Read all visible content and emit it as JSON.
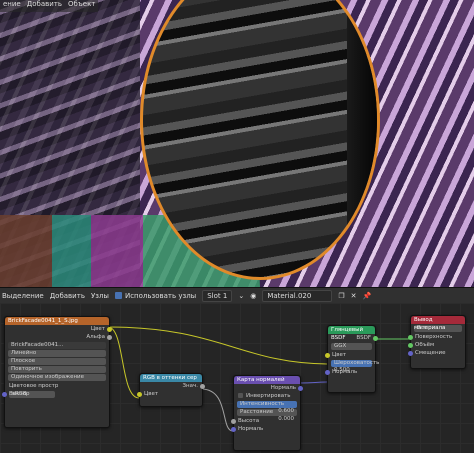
{
  "viewport_menu": [
    "ение",
    "Добавить",
    "Объект"
  ],
  "header": {
    "items": [
      "Выделение",
      "Добавить",
      "Узлы"
    ],
    "use_nodes_label": "Использовать узлы",
    "slot": "Slot 1",
    "material": "Material.020"
  },
  "image_node": {
    "title": "BrickFacade0041_1_S.jpg",
    "out_color": "Цвет",
    "out_alpha": "Альфа",
    "image_name": "BrickFacade0041...",
    "interp": "Линейно",
    "proj": "Плоское",
    "ext": "Повторить",
    "source": "Одиночное изображение",
    "colorspace_label": "Цветовое простр",
    "colorspace_value": "sRGB",
    "in_vector": "Вектор"
  },
  "rgbbw_node": {
    "title": "RGB в оттенки сер",
    "out": "Знач.",
    "in": "Цвет"
  },
  "normal_node": {
    "title": "Карта нормалей",
    "out": "Нормаль",
    "invert": "Инвертировать",
    "strength_label": "Интенсивность",
    "strength": "0.600",
    "distance_label": "Расстояние",
    "distance": "0.000",
    "height": "Высота",
    "normal_in": "Нормаль"
  },
  "glossy_node": {
    "title": "Глянцевый BSDF",
    "out": "BSDF",
    "dist": "GGX",
    "color": "Цвет",
    "rough_label": "Шероховатость",
    "rough": "0.500",
    "normal": "Нормаль"
  },
  "output_node": {
    "title": "Вывод материала",
    "target": "Все",
    "surface": "Поверхность",
    "volume": "Объём",
    "displace": "Смещение"
  },
  "colors": {
    "image": "#b5642a",
    "rgb": "#3a88a6",
    "vector": "#6a4fb0",
    "shader": "#2a9a5a",
    "output": "#a52a3a"
  }
}
